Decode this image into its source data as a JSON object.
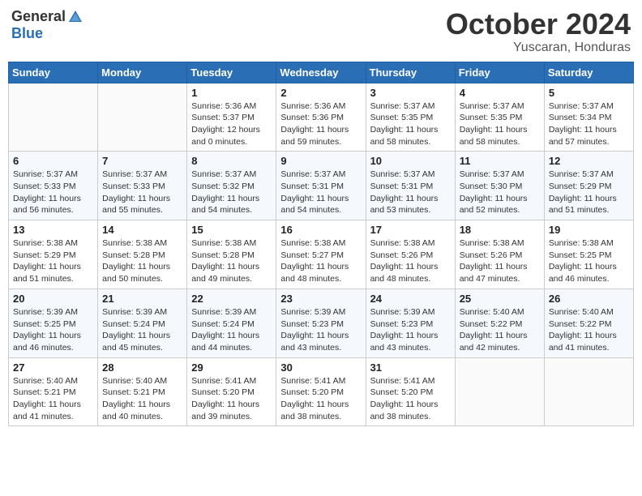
{
  "header": {
    "logo_general": "General",
    "logo_blue": "Blue",
    "month_title": "October 2024",
    "subtitle": "Yuscaran, Honduras"
  },
  "weekdays": [
    "Sunday",
    "Monday",
    "Tuesday",
    "Wednesday",
    "Thursday",
    "Friday",
    "Saturday"
  ],
  "weeks": [
    [
      null,
      null,
      {
        "day": "1",
        "sunrise": "5:36 AM",
        "sunset": "5:37 PM",
        "daylight": "12 hours and 0 minutes."
      },
      {
        "day": "2",
        "sunrise": "5:36 AM",
        "sunset": "5:36 PM",
        "daylight": "11 hours and 59 minutes."
      },
      {
        "day": "3",
        "sunrise": "5:37 AM",
        "sunset": "5:35 PM",
        "daylight": "11 hours and 58 minutes."
      },
      {
        "day": "4",
        "sunrise": "5:37 AM",
        "sunset": "5:35 PM",
        "daylight": "11 hours and 58 minutes."
      },
      {
        "day": "5",
        "sunrise": "5:37 AM",
        "sunset": "5:34 PM",
        "daylight": "11 hours and 57 minutes."
      }
    ],
    [
      {
        "day": "6",
        "sunrise": "5:37 AM",
        "sunset": "5:33 PM",
        "daylight": "11 hours and 56 minutes."
      },
      {
        "day": "7",
        "sunrise": "5:37 AM",
        "sunset": "5:33 PM",
        "daylight": "11 hours and 55 minutes."
      },
      {
        "day": "8",
        "sunrise": "5:37 AM",
        "sunset": "5:32 PM",
        "daylight": "11 hours and 54 minutes."
      },
      {
        "day": "9",
        "sunrise": "5:37 AM",
        "sunset": "5:31 PM",
        "daylight": "11 hours and 54 minutes."
      },
      {
        "day": "10",
        "sunrise": "5:37 AM",
        "sunset": "5:31 PM",
        "daylight": "11 hours and 53 minutes."
      },
      {
        "day": "11",
        "sunrise": "5:37 AM",
        "sunset": "5:30 PM",
        "daylight": "11 hours and 52 minutes."
      },
      {
        "day": "12",
        "sunrise": "5:37 AM",
        "sunset": "5:29 PM",
        "daylight": "11 hours and 51 minutes."
      }
    ],
    [
      {
        "day": "13",
        "sunrise": "5:38 AM",
        "sunset": "5:29 PM",
        "daylight": "11 hours and 51 minutes."
      },
      {
        "day": "14",
        "sunrise": "5:38 AM",
        "sunset": "5:28 PM",
        "daylight": "11 hours and 50 minutes."
      },
      {
        "day": "15",
        "sunrise": "5:38 AM",
        "sunset": "5:28 PM",
        "daylight": "11 hours and 49 minutes."
      },
      {
        "day": "16",
        "sunrise": "5:38 AM",
        "sunset": "5:27 PM",
        "daylight": "11 hours and 48 minutes."
      },
      {
        "day": "17",
        "sunrise": "5:38 AM",
        "sunset": "5:26 PM",
        "daylight": "11 hours and 48 minutes."
      },
      {
        "day": "18",
        "sunrise": "5:38 AM",
        "sunset": "5:26 PM",
        "daylight": "11 hours and 47 minutes."
      },
      {
        "day": "19",
        "sunrise": "5:38 AM",
        "sunset": "5:25 PM",
        "daylight": "11 hours and 46 minutes."
      }
    ],
    [
      {
        "day": "20",
        "sunrise": "5:39 AM",
        "sunset": "5:25 PM",
        "daylight": "11 hours and 46 minutes."
      },
      {
        "day": "21",
        "sunrise": "5:39 AM",
        "sunset": "5:24 PM",
        "daylight": "11 hours and 45 minutes."
      },
      {
        "day": "22",
        "sunrise": "5:39 AM",
        "sunset": "5:24 PM",
        "daylight": "11 hours and 44 minutes."
      },
      {
        "day": "23",
        "sunrise": "5:39 AM",
        "sunset": "5:23 PM",
        "daylight": "11 hours and 43 minutes."
      },
      {
        "day": "24",
        "sunrise": "5:39 AM",
        "sunset": "5:23 PM",
        "daylight": "11 hours and 43 minutes."
      },
      {
        "day": "25",
        "sunrise": "5:40 AM",
        "sunset": "5:22 PM",
        "daylight": "11 hours and 42 minutes."
      },
      {
        "day": "26",
        "sunrise": "5:40 AM",
        "sunset": "5:22 PM",
        "daylight": "11 hours and 41 minutes."
      }
    ],
    [
      {
        "day": "27",
        "sunrise": "5:40 AM",
        "sunset": "5:21 PM",
        "daylight": "11 hours and 41 minutes."
      },
      {
        "day": "28",
        "sunrise": "5:40 AM",
        "sunset": "5:21 PM",
        "daylight": "11 hours and 40 minutes."
      },
      {
        "day": "29",
        "sunrise": "5:41 AM",
        "sunset": "5:20 PM",
        "daylight": "11 hours and 39 minutes."
      },
      {
        "day": "30",
        "sunrise": "5:41 AM",
        "sunset": "5:20 PM",
        "daylight": "11 hours and 38 minutes."
      },
      {
        "day": "31",
        "sunrise": "5:41 AM",
        "sunset": "5:20 PM",
        "daylight": "11 hours and 38 minutes."
      },
      null,
      null
    ]
  ]
}
